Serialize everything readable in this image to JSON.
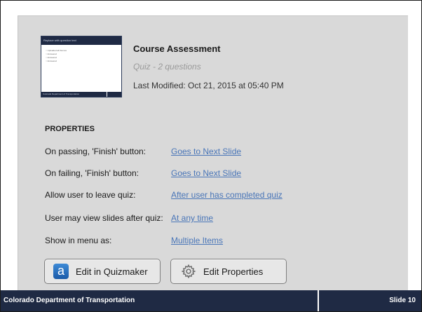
{
  "course": {
    "title": "Course Assessment",
    "subtitle": "Quiz - 2 questions",
    "modified": "Last Modified: Oct 21, 2015 at 05:40 PM"
  },
  "thumbnail": {
    "header": "Replace with question text",
    "options": [
      "Uploaded all themes",
      "Answered",
      "Answered",
      "Answered"
    ],
    "footer": "Colorado Department of Transportation"
  },
  "properties": {
    "heading": "PROPERTIES",
    "rows": [
      {
        "label": "On passing, 'Finish' button:",
        "value": "Goes to Next Slide"
      },
      {
        "label": "On failing, 'Finish' button:",
        "value": "Goes to Next Slide"
      },
      {
        "label": "Allow user to leave quiz:",
        "value": "After user has completed quiz"
      },
      {
        "label": "User may view slides after quiz:",
        "value": "At any time"
      },
      {
        "label": "Show in menu as:",
        "value": "Multiple Items"
      }
    ]
  },
  "buttons": {
    "quizmaker": "Edit in Quizmaker",
    "quizmaker_icon_glyph": "a",
    "properties": "Edit Properties"
  },
  "footer": {
    "left": "Colorado Department of Transportation",
    "right": "Slide 10"
  },
  "colors": {
    "accent_link": "#4a76b8",
    "footer_bg": "#1f2a44",
    "panel_bg": "#d9d9d9"
  },
  "icons": [
    "quizmaker-icon",
    "gear-icon"
  ]
}
